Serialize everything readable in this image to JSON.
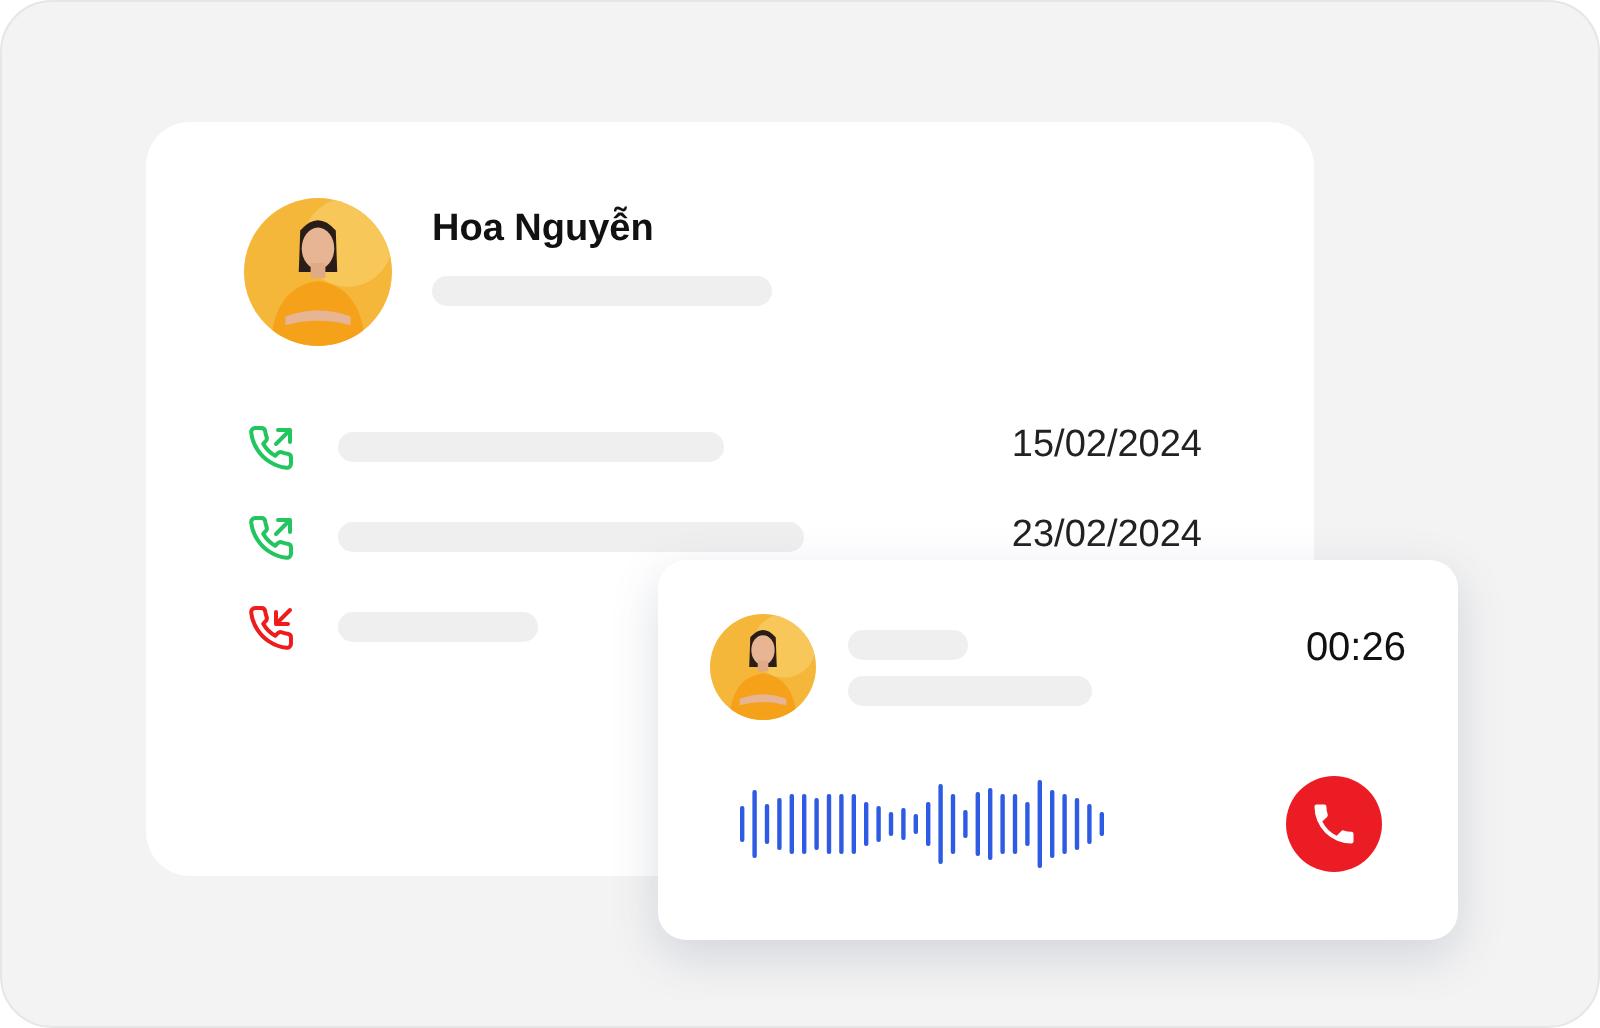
{
  "contact": {
    "name": "Hoa Nguyễn"
  },
  "calls": [
    {
      "kind": "outgoing",
      "date": "15/02/2024"
    },
    {
      "kind": "outgoing",
      "date": "23/02/2024"
    },
    {
      "kind": "missed"
    }
  ],
  "active_call": {
    "duration": "00:26"
  }
}
